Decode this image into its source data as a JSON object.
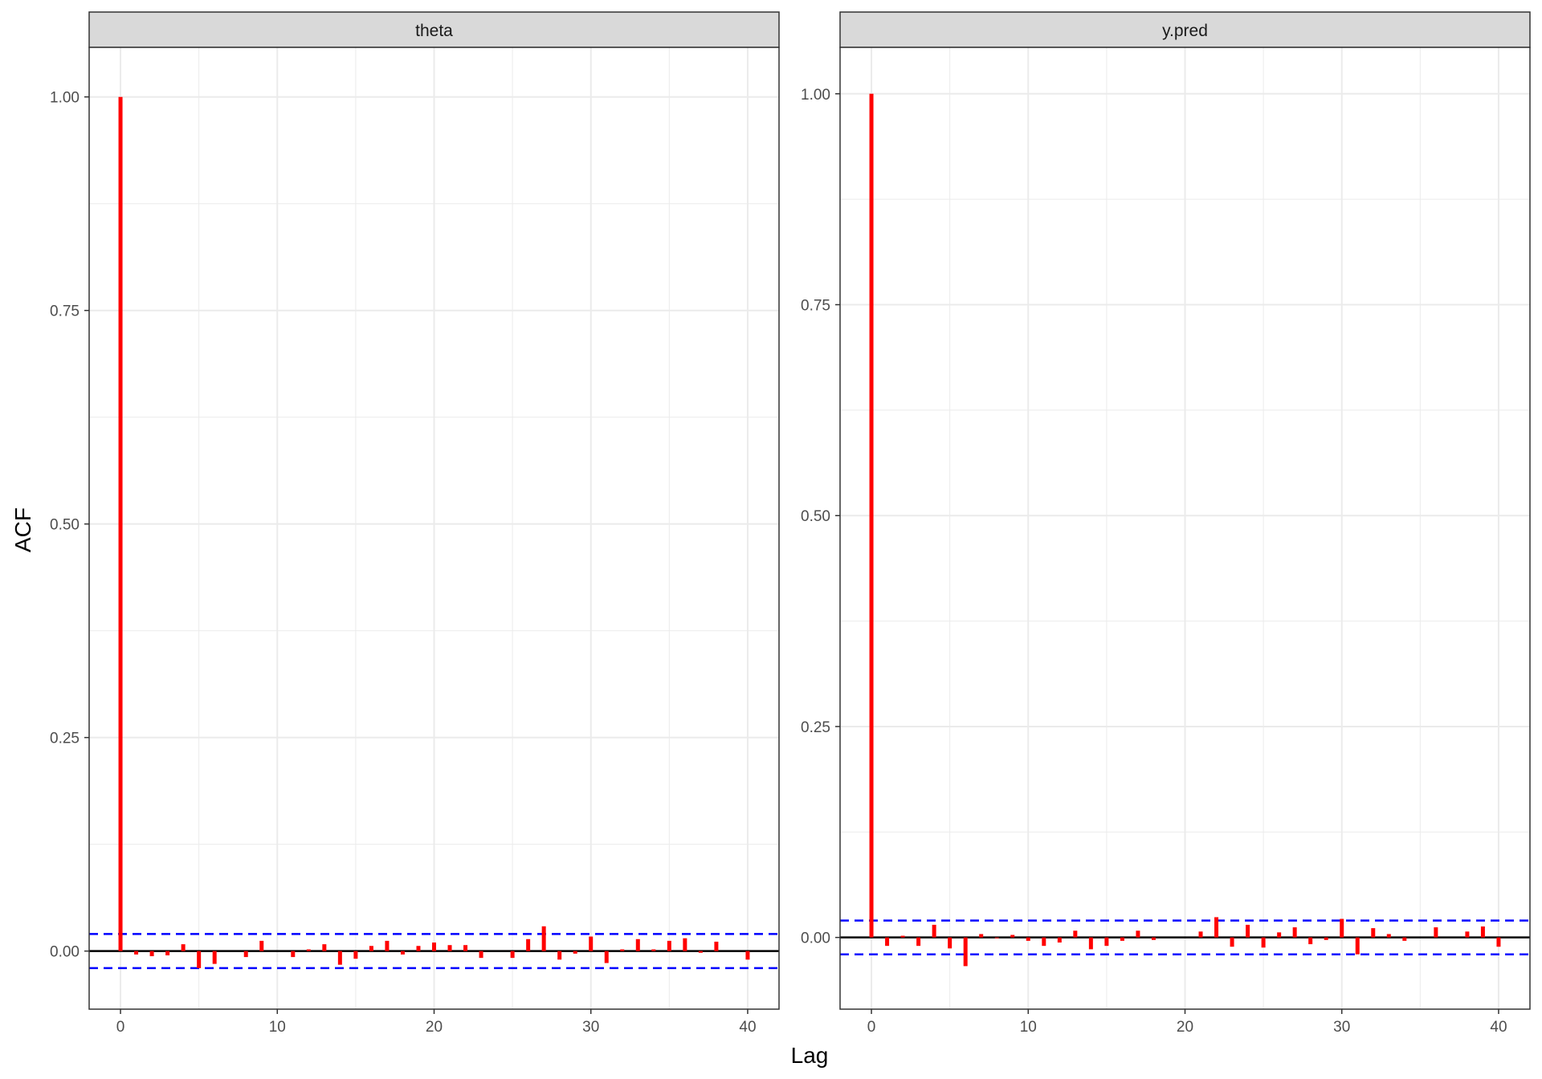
{
  "figure": {
    "xlabel": "Lag",
    "ylabel": "ACF"
  },
  "colors": {
    "bar": "#ff0000",
    "ci": "#0000ff",
    "zero_line": "#000000",
    "strip_bg": "#d9d9d9",
    "grid": "#ebebeb",
    "panel_border": "#333333"
  },
  "chart_data": [
    {
      "type": "bar",
      "title": "theta",
      "xlabel": "Lag",
      "ylabel": "ACF",
      "xlim": [
        -2,
        42
      ],
      "ylim": [
        -0.068,
        1.058
      ],
      "xticks": [
        0,
        10,
        20,
        30,
        40
      ],
      "xtick_labels": [
        "0",
        "10",
        "20",
        "30",
        "40"
      ],
      "yticks": [
        0.0,
        0.25,
        0.5,
        0.75,
        1.0
      ],
      "ytick_labels": [
        "0.00",
        "0.25",
        "0.50",
        "0.75",
        "1.00"
      ],
      "grid": true,
      "ci": [
        0.02,
        -0.02
      ],
      "lags": [
        0,
        1,
        2,
        3,
        4,
        5,
        6,
        7,
        8,
        9,
        10,
        11,
        12,
        13,
        14,
        15,
        16,
        17,
        18,
        19,
        20,
        21,
        22,
        23,
        24,
        25,
        26,
        27,
        28,
        29,
        30,
        31,
        32,
        33,
        34,
        35,
        36,
        37,
        38,
        39,
        40
      ],
      "values": [
        1.0,
        -0.004,
        -0.006,
        -0.005,
        0.008,
        -0.02,
        -0.015,
        0.0,
        -0.007,
        0.012,
        0.0,
        -0.007,
        0.002,
        0.008,
        -0.016,
        -0.009,
        0.006,
        0.012,
        -0.004,
        0.006,
        0.01,
        0.007,
        0.007,
        -0.008,
        0.0,
        -0.008,
        0.014,
        0.029,
        -0.01,
        -0.003,
        0.017,
        -0.014,
        0.002,
        0.014,
        0.002,
        0.012,
        0.015,
        -0.002,
        0.011,
        0.0,
        -0.01
      ]
    },
    {
      "type": "bar",
      "title": "y.pred",
      "xlabel": "Lag",
      "ylabel": "ACF",
      "xlim": [
        -2,
        42
      ],
      "ylim": [
        -0.085,
        1.055
      ],
      "xticks": [
        0,
        10,
        20,
        30,
        40
      ],
      "xtick_labels": [
        "0",
        "10",
        "20",
        "30",
        "40"
      ],
      "yticks": [
        0.0,
        0.25,
        0.5,
        0.75,
        1.0
      ],
      "ytick_labels": [
        "0.00",
        "0.25",
        "0.50",
        "0.75",
        "1.00"
      ],
      "grid": true,
      "ci": [
        0.02,
        -0.02
      ],
      "lags": [
        0,
        1,
        2,
        3,
        4,
        5,
        6,
        7,
        8,
        9,
        10,
        11,
        12,
        13,
        14,
        15,
        16,
        17,
        18,
        19,
        20,
        21,
        22,
        23,
        24,
        25,
        26,
        27,
        28,
        29,
        30,
        31,
        32,
        33,
        34,
        35,
        36,
        37,
        38,
        39,
        40
      ],
      "values": [
        1.0,
        -0.01,
        0.002,
        -0.01,
        0.015,
        -0.013,
        -0.034,
        0.004,
        -0.001,
        0.003,
        -0.004,
        -0.01,
        -0.006,
        0.008,
        -0.014,
        -0.01,
        -0.004,
        0.008,
        -0.003,
        0.0,
        0.0,
        0.007,
        0.024,
        -0.011,
        0.015,
        -0.012,
        0.006,
        0.012,
        -0.008,
        -0.003,
        0.022,
        -0.02,
        0.011,
        0.004,
        -0.004,
        0.0,
        0.012,
        0.0,
        0.007,
        0.013,
        -0.011
      ]
    }
  ]
}
